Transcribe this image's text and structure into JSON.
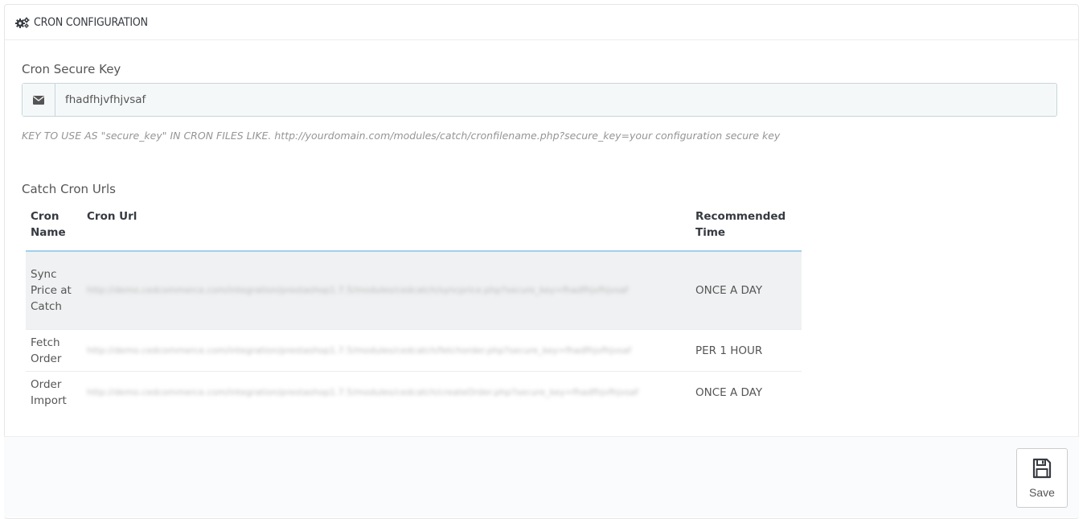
{
  "panel": {
    "title": "CRON CONFIGURATION",
    "icon": "gears-icon"
  },
  "secure_key": {
    "label": "Cron Secure Key",
    "icon": "envelope-icon",
    "value": "fhadfhjvfhjvsaf",
    "help": "KEY TO USE AS \"secure_key\" IN CRON FILES LIKE. http://yourdomain.com/modules/catch/cronfilename.php?secure_key=your configuration secure key"
  },
  "cron_urls": {
    "label": "Catch Cron Urls",
    "headers": {
      "name": "Cron Name",
      "url": "Cron Url",
      "time": "Recommended Time"
    },
    "rows": [
      {
        "name": "Sync Price at Catch",
        "url": "http://demo.cedcommerce.com/integration/prestashop1.7.5/modules/cedcatch/syncprice.php?secure_key=fhadfhjvfhjvsaf",
        "time": "ONCE A DAY"
      },
      {
        "name": "Fetch Order",
        "url": "http://demo.cedcommerce.com/integration/prestashop1.7.5/modules/cedcatch/fetchorder.php?secure_key=fhadfhjvfhjvsaf",
        "time": "PER 1 HOUR"
      },
      {
        "name": "Order Import",
        "url": "http://demo.cedcommerce.com/integration/prestashop1.7.5/modules/cedcatch/createOrder.php?secure_key=fhadfhjvfhjvsaf",
        "time": "ONCE A DAY"
      }
    ]
  },
  "footer": {
    "save_label": "Save",
    "save_icon": "floppy-disk-icon"
  }
}
